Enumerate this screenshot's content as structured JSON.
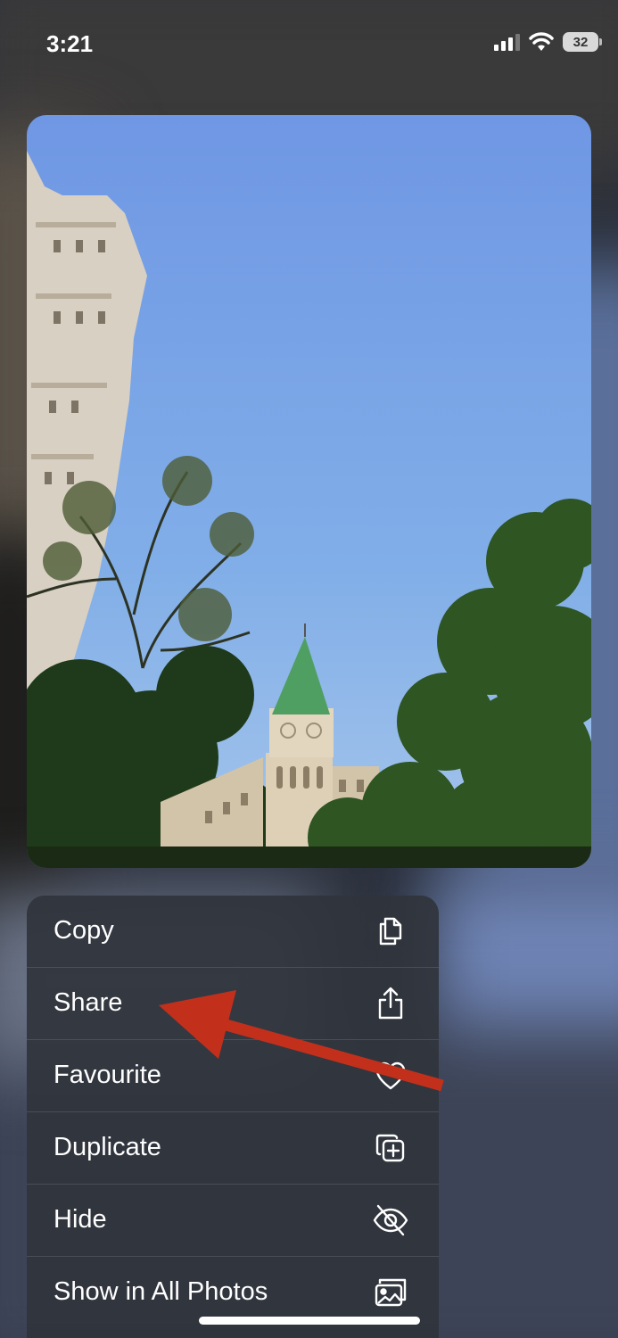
{
  "status_bar": {
    "time": "3:21",
    "battery": "32",
    "icons": [
      "cellular-signal-icon",
      "wifi-icon",
      "battery-icon"
    ]
  },
  "photo": {
    "subject": "Clock tower with green spire, tall building, trees under blue sky"
  },
  "menu": {
    "items": [
      {
        "label": "Copy",
        "icon": "copy-icon"
      },
      {
        "label": "Share",
        "icon": "share-icon"
      },
      {
        "label": "Favourite",
        "icon": "heart-icon"
      },
      {
        "label": "Duplicate",
        "icon": "duplicate-icon"
      },
      {
        "label": "Hide",
        "icon": "eye-slash-icon"
      },
      {
        "label": "Show in All Photos",
        "icon": "photos-icon"
      }
    ]
  },
  "annotation": {
    "color": "#c2301c",
    "points_to": "Share"
  }
}
